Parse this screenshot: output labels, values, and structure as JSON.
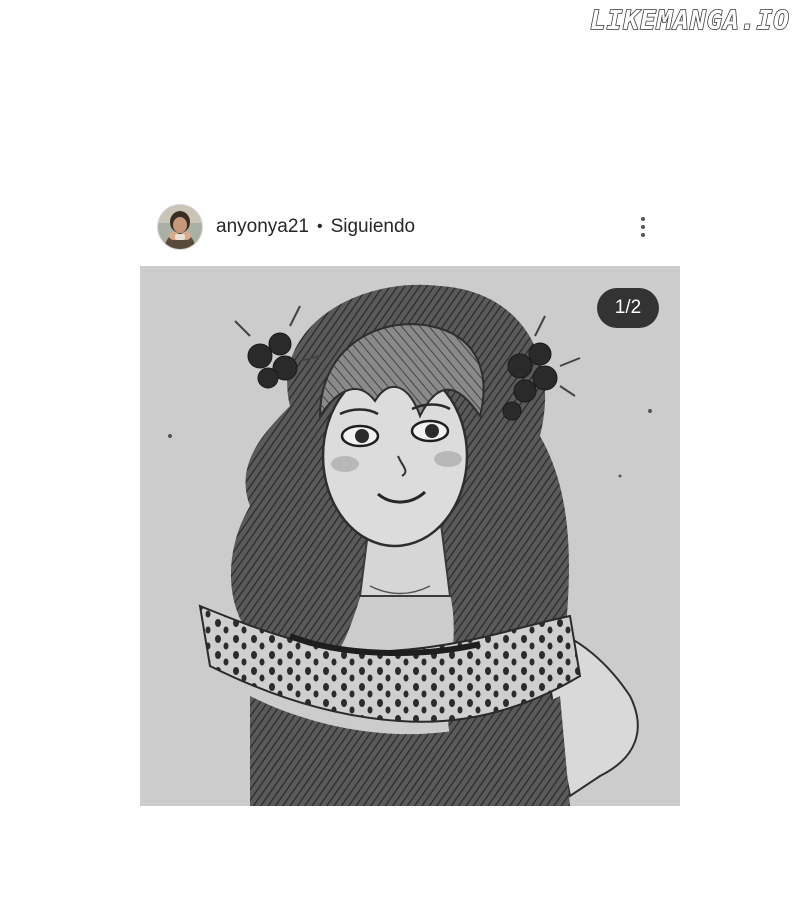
{
  "watermark": "LIKEMANGA.IO",
  "post": {
    "username": "anyonya21",
    "separator": "•",
    "follow_status": "Siguiendo",
    "image_counter": "1/2"
  },
  "icons": {
    "more": "more-vertical-icon"
  }
}
